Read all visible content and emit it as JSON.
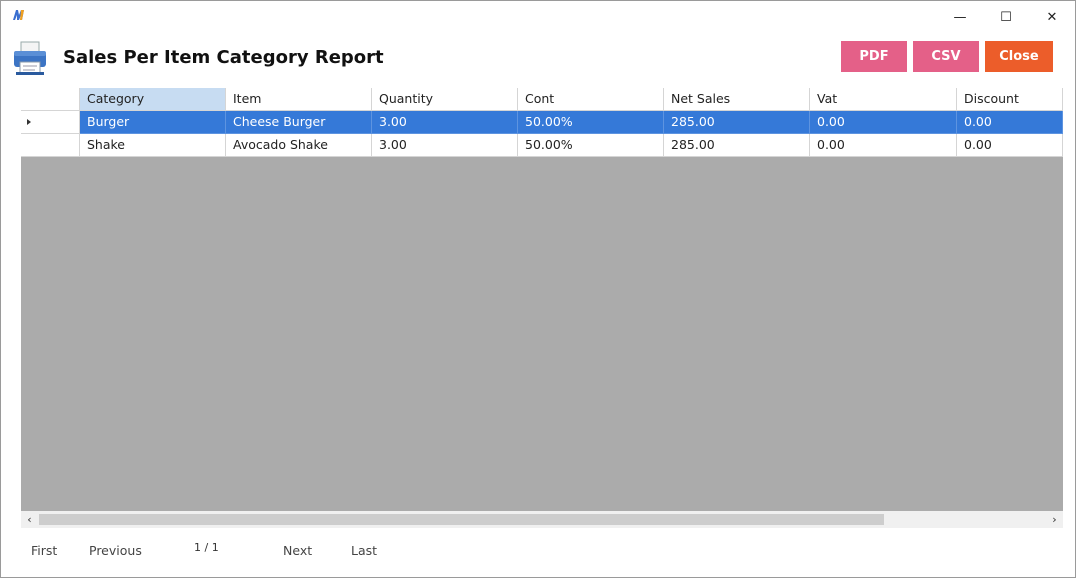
{
  "window": {
    "controls": {
      "minimize": "—",
      "maximize": "☐",
      "close": "✕"
    }
  },
  "header": {
    "title": "Sales Per Item Category Report",
    "buttons": {
      "pdf": "PDF",
      "csv": "CSV",
      "close": "Close"
    },
    "colors": {
      "pdf": "#e46088",
      "csv": "#e46088",
      "close": "#ec5d2a"
    }
  },
  "grid": {
    "columns": [
      "Category",
      "Item",
      "Quantity",
      "Cont",
      "Net Sales",
      "Vat",
      "Discount"
    ],
    "rows": [
      [
        "Burger",
        "Cheese Burger",
        "3.00",
        "50.00%",
        "285.00",
        "0.00",
        "0.00"
      ],
      [
        "Shake",
        "Avocado Shake",
        "3.00",
        "50.00%",
        "285.00",
        "0.00",
        "0.00"
      ]
    ],
    "selected_row": 0,
    "selection_color": "#3579d8"
  },
  "scrollbar": {
    "left": "‹",
    "right": "›"
  },
  "pager": {
    "first": "First",
    "previous": "Previous",
    "page_info": "1 / 1",
    "next": "Next",
    "last": "Last"
  }
}
